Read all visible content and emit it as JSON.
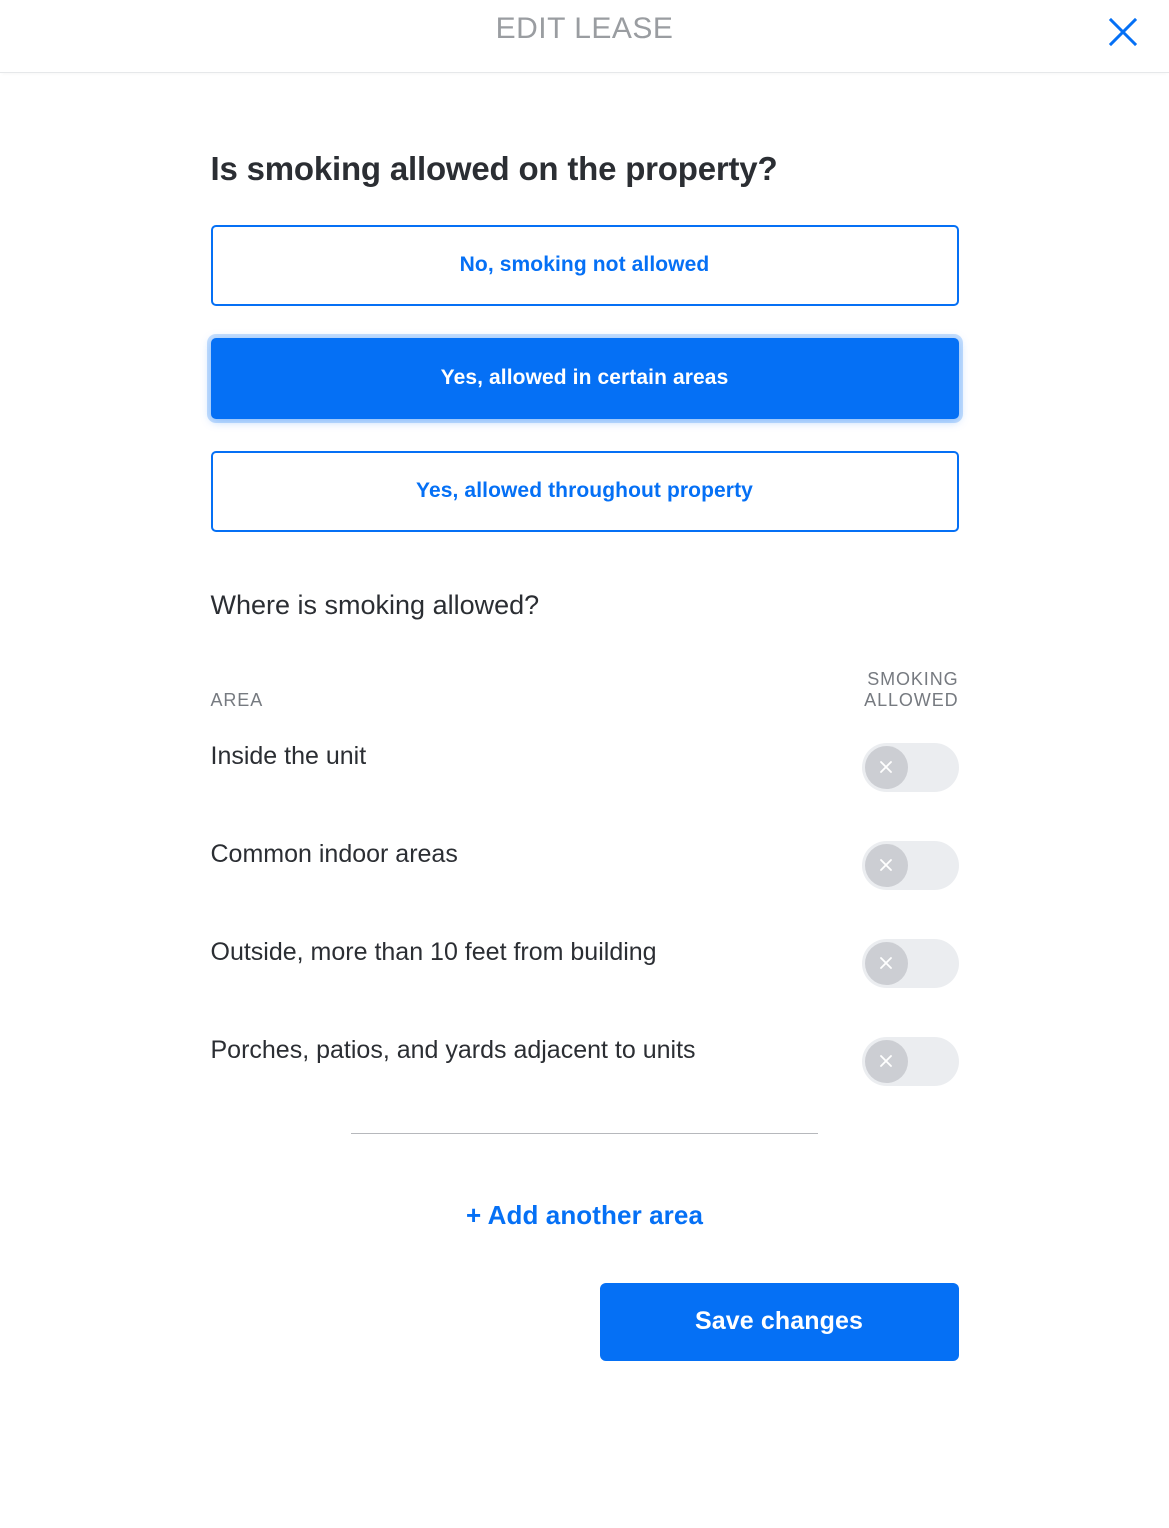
{
  "header": {
    "title": "EDIT LEASE",
    "close_icon": "close-icon"
  },
  "main": {
    "question": "Is smoking allowed on the property?",
    "options": [
      {
        "label": "No, smoking not allowed",
        "selected": false
      },
      {
        "label": "Yes, allowed in certain areas",
        "selected": true
      },
      {
        "label": "Yes, allowed throughout property",
        "selected": false
      }
    ],
    "sub_question": "Where is smoking allowed?",
    "table": {
      "columns": [
        "AREA",
        "SMOKING ALLOWED"
      ],
      "rows": [
        {
          "area": "Inside the unit",
          "smoking_allowed": false,
          "toggle_icon": "x-icon"
        },
        {
          "area": "Common indoor areas",
          "smoking_allowed": false,
          "toggle_icon": "x-icon"
        },
        {
          "area": "Outside, more than 10 feet from building",
          "smoking_allowed": false,
          "toggle_icon": "x-icon"
        },
        {
          "area": "Porches, patios, and yards adjacent to units",
          "smoking_allowed": false,
          "toggle_icon": "x-icon"
        }
      ]
    },
    "add_area_label": "+ Add another area",
    "save_label": "Save changes"
  },
  "colors": {
    "brand_blue": "#0570f5",
    "title_gray": "#9a9da1",
    "text_dark": "#2b2e33",
    "label_gray": "#767a80",
    "toggle_track": "#ebedf0",
    "toggle_knob": "#ccced3"
  }
}
